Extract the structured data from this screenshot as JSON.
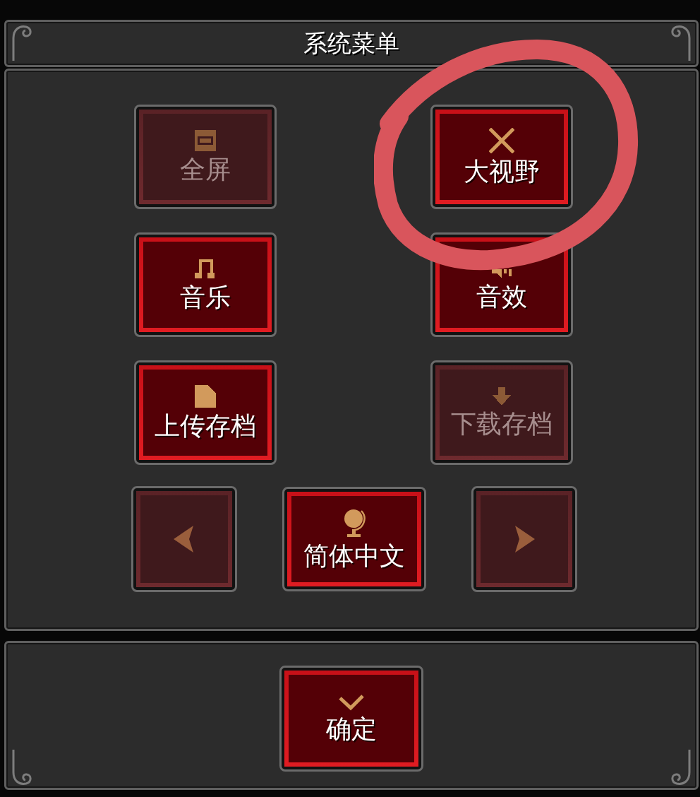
{
  "window": {
    "title": "系统菜单"
  },
  "buttons": [
    {
      "label": "全屏",
      "disabled": true
    },
    {
      "label": "大视野",
      "disabled": false
    },
    {
      "label": "音乐",
      "disabled": false
    },
    {
      "label": "音效",
      "disabled": false
    },
    {
      "label": "上传存档",
      "disabled": false
    },
    {
      "label": "下载存档",
      "disabled": true
    }
  ],
  "language": {
    "previous": {
      "disabled": true
    },
    "label": "简体中文",
    "next": {
      "disabled": true
    }
  },
  "footer": {
    "confirm_button": {
      "label": "确定"
    }
  },
  "annotation": {
    "kind": "circle"
  }
}
